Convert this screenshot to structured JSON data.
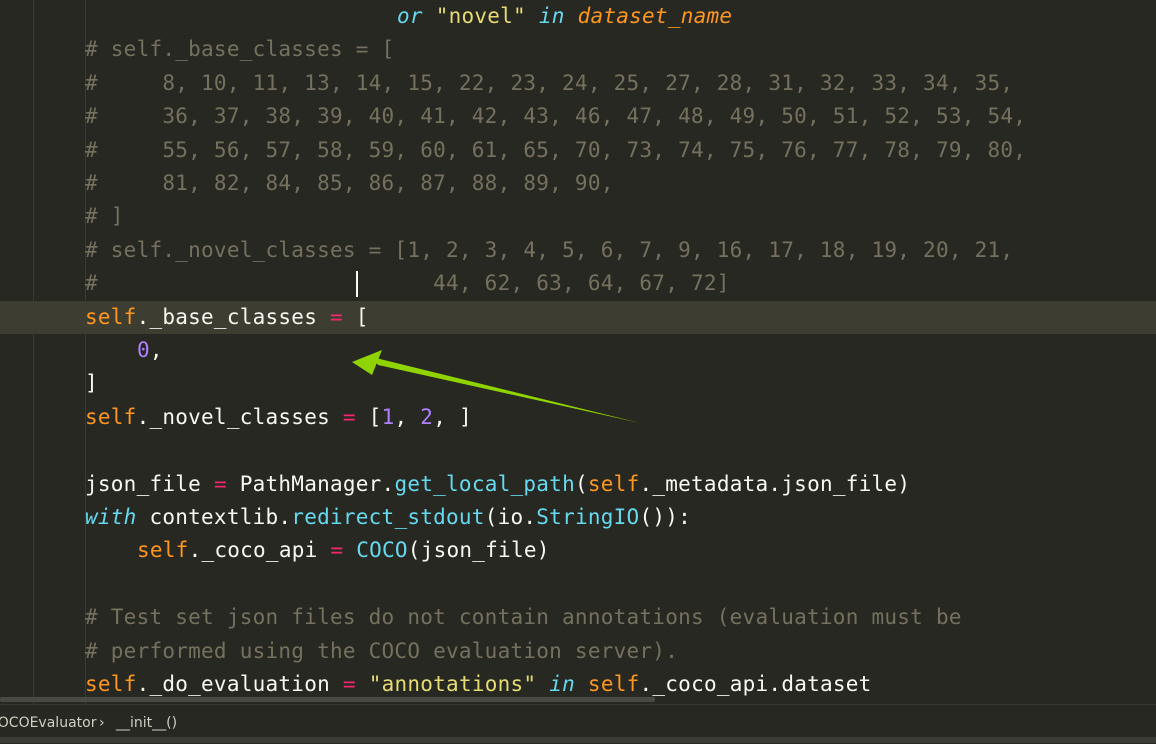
{
  "editor": {
    "caret_line": 9,
    "lines": [
      {
        "indent": 14,
        "tokens": [
          {
            "t": "or",
            "c": "kw"
          },
          {
            "t": " ",
            "c": "plain"
          },
          {
            "t": "\"novel\"",
            "c": "str"
          },
          {
            "t": " ",
            "c": "plain"
          },
          {
            "t": "in",
            "c": "kw"
          },
          {
            "t": " ",
            "c": "plain"
          },
          {
            "t": "dataset_name",
            "c": "param"
          }
        ]
      },
      {
        "indent": 2,
        "tokens": [
          {
            "t": "# self._base_classes = [",
            "c": "comment"
          }
        ]
      },
      {
        "indent": 2,
        "tokens": [
          {
            "t": "#     8, 10, 11, 13, 14, 15, 22, 23, 24, 25, 27, 28, 31, 32, 33, 34, 35,",
            "c": "comment"
          }
        ]
      },
      {
        "indent": 2,
        "tokens": [
          {
            "t": "#     36, 37, 38, 39, 40, 41, 42, 43, 46, 47, 48, 49, 50, 51, 52, 53, 54,",
            "c": "comment"
          }
        ]
      },
      {
        "indent": 2,
        "tokens": [
          {
            "t": "#     55, 56, 57, 58, 59, 60, 61, 65, 70, 73, 74, 75, 76, 77, 78, 79, 80,",
            "c": "comment"
          }
        ]
      },
      {
        "indent": 2,
        "tokens": [
          {
            "t": "#     81, 82, 84, 85, 86, 87, 88, 89, 90,",
            "c": "comment"
          }
        ]
      },
      {
        "indent": 2,
        "tokens": [
          {
            "t": "# ]",
            "c": "comment"
          }
        ]
      },
      {
        "indent": 2,
        "tokens": [
          {
            "t": "# self._novel_classes = [1, 2, 3, 4, 5, 6, 7, 9, 16, 17, 18, 19, 20, 21,",
            "c": "comment"
          }
        ]
      },
      {
        "indent": 2,
        "tokens": [
          {
            "t": "#                          44, 62, 63, 64, 67, 72]",
            "c": "comment"
          }
        ]
      },
      {
        "indent": 2,
        "tokens": [
          {
            "t": "self",
            "c": "self"
          },
          {
            "t": "._base_classes ",
            "c": "plain"
          },
          {
            "t": "=",
            "c": "op"
          },
          {
            "t": " [",
            "c": "plain"
          }
        ]
      },
      {
        "indent": 4,
        "tokens": [
          {
            "t": "0",
            "c": "num"
          },
          {
            "t": ",",
            "c": "plain"
          }
        ]
      },
      {
        "indent": 2,
        "tokens": [
          {
            "t": "]",
            "c": "plain"
          }
        ]
      },
      {
        "indent": 2,
        "tokens": [
          {
            "t": "self",
            "c": "self"
          },
          {
            "t": "._novel_classes ",
            "c": "plain"
          },
          {
            "t": "=",
            "c": "op"
          },
          {
            "t": " [",
            "c": "plain"
          },
          {
            "t": "1",
            "c": "num"
          },
          {
            "t": ", ",
            "c": "plain"
          },
          {
            "t": "2",
            "c": "num"
          },
          {
            "t": ", ]",
            "c": "plain"
          }
        ]
      },
      {
        "indent": 0,
        "tokens": []
      },
      {
        "indent": 2,
        "tokens": [
          {
            "t": "json_file ",
            "c": "plain"
          },
          {
            "t": "=",
            "c": "op"
          },
          {
            "t": " PathManager.",
            "c": "plain"
          },
          {
            "t": "get_local_path",
            "c": "fn"
          },
          {
            "t": "(",
            "c": "plain"
          },
          {
            "t": "self",
            "c": "self"
          },
          {
            "t": "._metadata.json_file)",
            "c": "plain"
          }
        ]
      },
      {
        "indent": 2,
        "tokens": [
          {
            "t": "with",
            "c": "kw"
          },
          {
            "t": " contextlib.",
            "c": "plain"
          },
          {
            "t": "redirect_stdout",
            "c": "fn"
          },
          {
            "t": "(io.",
            "c": "plain"
          },
          {
            "t": "StringIO",
            "c": "fn"
          },
          {
            "t": "()):",
            "c": "plain"
          }
        ]
      },
      {
        "indent": 4,
        "tokens": [
          {
            "t": "self",
            "c": "self"
          },
          {
            "t": "._coco_api ",
            "c": "plain"
          },
          {
            "t": "=",
            "c": "op"
          },
          {
            "t": " ",
            "c": "plain"
          },
          {
            "t": "COCO",
            "c": "fn"
          },
          {
            "t": "(json_file)",
            "c": "plain"
          }
        ]
      },
      {
        "indent": 0,
        "tokens": []
      },
      {
        "indent": 2,
        "tokens": [
          {
            "t": "# Test set json files do not contain annotations (evaluation must be",
            "c": "comment"
          }
        ]
      },
      {
        "indent": 2,
        "tokens": [
          {
            "t": "# performed using the COCO evaluation server).",
            "c": "comment"
          }
        ]
      },
      {
        "indent": 2,
        "tokens": [
          {
            "t": "self",
            "c": "self"
          },
          {
            "t": "._do_evaluation ",
            "c": "plain"
          },
          {
            "t": "=",
            "c": "op"
          },
          {
            "t": " ",
            "c": "plain"
          },
          {
            "t": "\"annotations\"",
            "c": "str"
          },
          {
            "t": " ",
            "c": "plain"
          },
          {
            "t": "in",
            "c": "kw"
          },
          {
            "t": " ",
            "c": "plain"
          },
          {
            "t": "self",
            "c": "self"
          },
          {
            "t": "._coco_api.dataset",
            "c": "plain"
          }
        ]
      }
    ]
  },
  "statusbar": {
    "crumb_class": "COCOEvaluator",
    "separator": "›",
    "crumb_method": "__init__()"
  },
  "colors": {
    "background": "#272822",
    "current_line": "#3e3d32",
    "keyword": "#66d9ef",
    "string": "#e6db74",
    "comment": "#75715e",
    "self": "#fd971f",
    "operator": "#f92672",
    "number": "#ae81ff",
    "annotation_arrow": "#8fd400"
  }
}
